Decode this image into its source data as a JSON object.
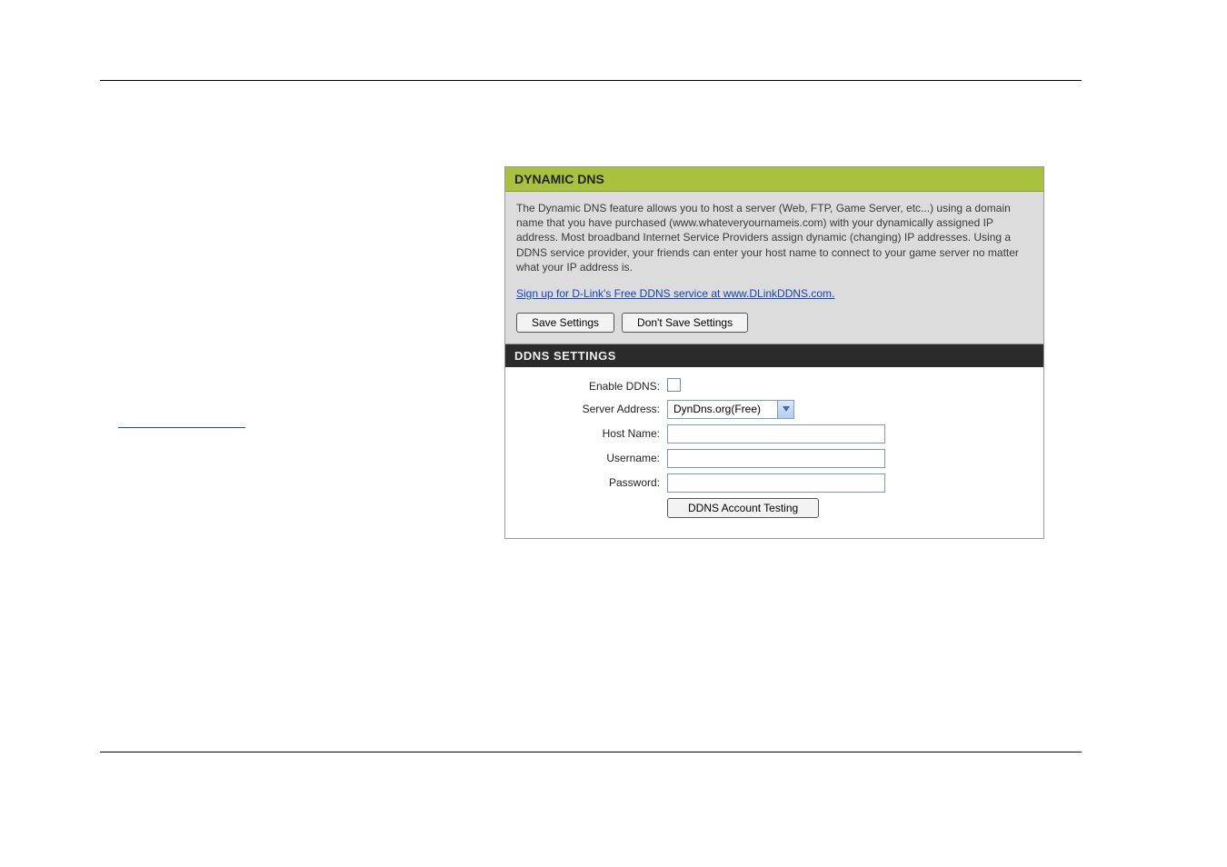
{
  "panel": {
    "header_title": "DYNAMIC DNS",
    "description": "The Dynamic DNS feature allows you to host a server (Web, FTP, Game Server, etc...) using a domain name that you have purchased (www.whateveryournameis.com) with your dynamically assigned IP address. Most broadband Internet Service Providers assign dynamic (changing) IP addresses. Using a DDNS service provider, your friends can enter your host name to connect to your game server no matter what your IP address is.",
    "signup_link": "Sign up for D-Link's Free DDNS service at www.DLinkDDNS.com.",
    "save_btn": "Save Settings",
    "dont_save_btn": "Don't Save Settings"
  },
  "settings": {
    "header_title": "DDNS SETTINGS",
    "enable_label": "Enable DDNS:",
    "enable_checked": false,
    "server_label": "Server Address:",
    "server_value": "DynDns.org(Free)",
    "host_label": "Host Name:",
    "host_value": "",
    "username_label": "Username:",
    "username_value": "",
    "password_label": "Password:",
    "password_value": "",
    "test_btn": "DDNS Account Testing"
  }
}
